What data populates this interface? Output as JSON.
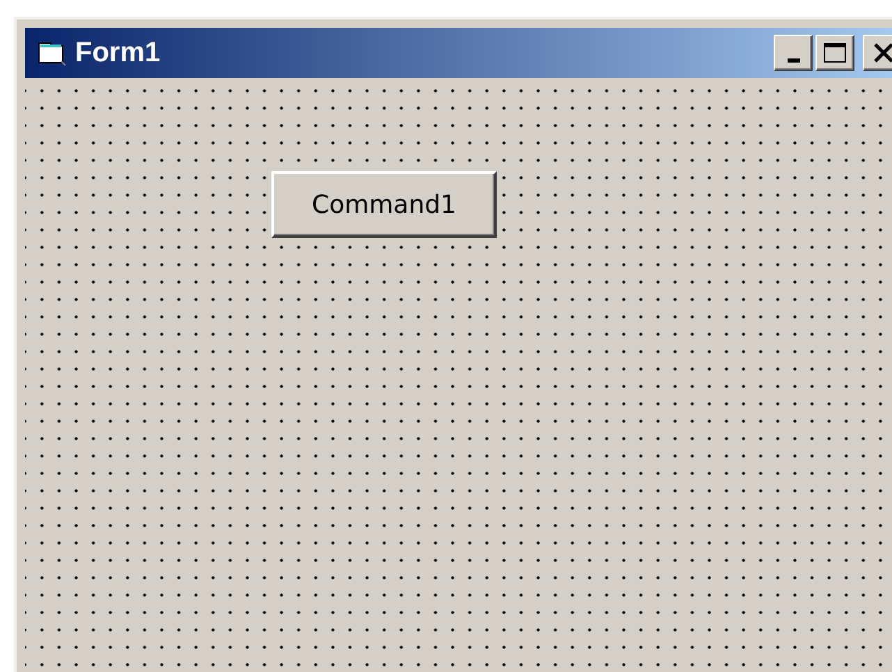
{
  "window": {
    "title": "Form1"
  },
  "controls": [
    {
      "kind": "command-button",
      "caption": "Command1"
    }
  ]
}
